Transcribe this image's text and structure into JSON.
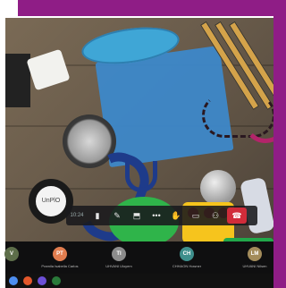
{
  "window": {
    "title": ""
  },
  "colors": {
    "frame": "#8f1d86",
    "end_call": "#d12c3a",
    "toolbar_bg": "#19191c"
  },
  "scene": {
    "speaker_label": "UnPlO"
  },
  "toolbar": {
    "time": "10:24",
    "buttons": [
      {
        "icon": "camera-icon",
        "glyph": "▮"
      },
      {
        "icon": "mic-off-icon",
        "glyph": "✎"
      },
      {
        "icon": "share-screen-icon",
        "glyph": "⬒"
      },
      {
        "icon": "more-icon",
        "glyph": "•••"
      },
      {
        "icon": "raise-hand-icon",
        "glyph": "✋"
      },
      {
        "icon": "chat-icon",
        "glyph": "▭"
      },
      {
        "icon": "participants-icon",
        "glyph": "⚇"
      }
    ],
    "end_call": {
      "icon": "hang-up-icon",
      "glyph": "☎"
    }
  },
  "participants": [
    {
      "initials": "V",
      "name": "",
      "color": "#5d6e4a"
    },
    {
      "initials": "PT",
      "name": "Pramila Isabella Carlos",
      "color": "#e17d4f"
    },
    {
      "initials": "TI",
      "name": "UHVANI Uloyem",
      "color": "#8c8c8c"
    },
    {
      "initials": "CH",
      "name": "CHHAON Howner",
      "color": "#3e8f8c"
    },
    {
      "initials": "LM",
      "name": "UHVANI Nilsen",
      "color": "#a38c5b"
    }
  ],
  "taskbar": {
    "icons": [
      {
        "name": "chrome-icon",
        "color": "#4d8ef0"
      },
      {
        "name": "firefox-icon",
        "color": "#e3572b"
      },
      {
        "name": "discord-icon",
        "color": "#6c4fd6"
      },
      {
        "name": "app-icon",
        "color": "#2a7a3a"
      }
    ]
  }
}
